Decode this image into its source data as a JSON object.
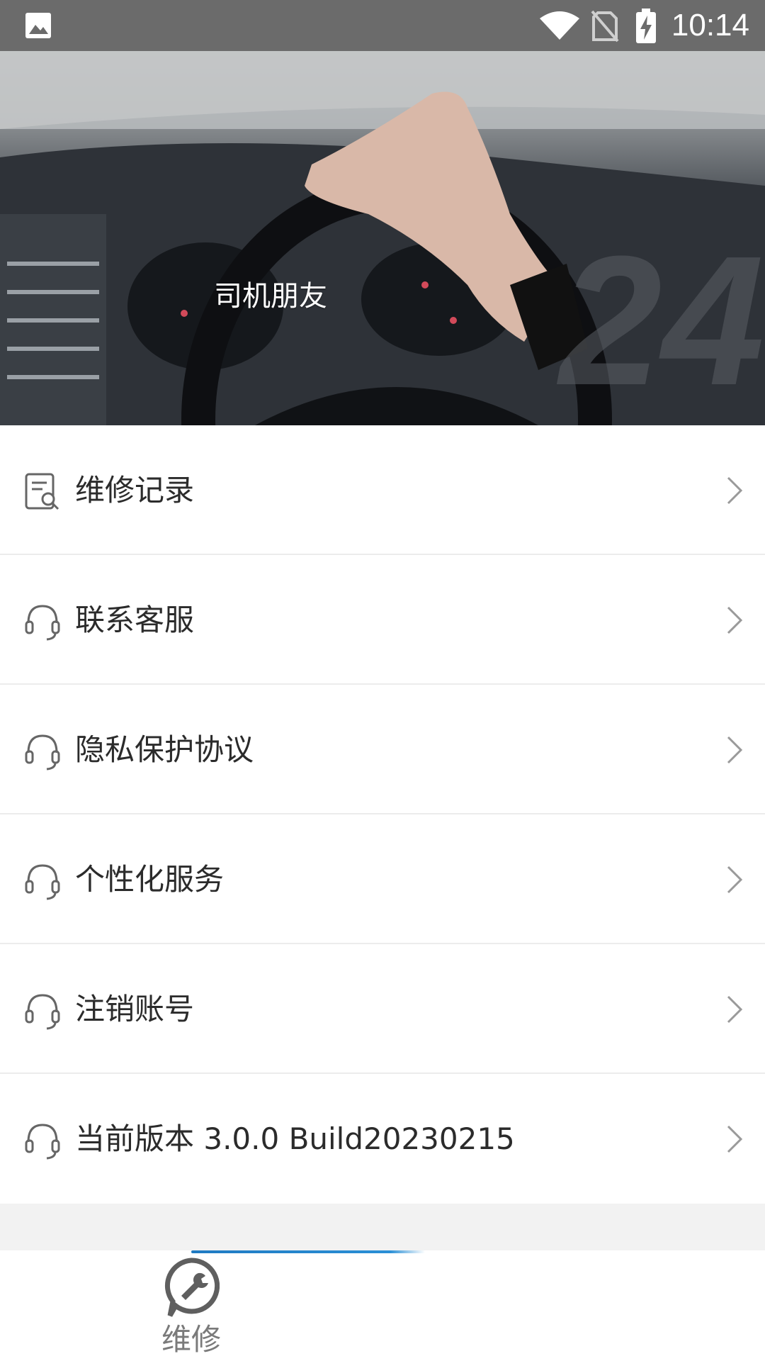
{
  "status_bar": {
    "time": "10:14",
    "icons": [
      "gallery-icon",
      "wifi-icon",
      "no-sim-icon",
      "battery-charging-icon"
    ]
  },
  "header": {
    "driver_name": "司机朋友",
    "background": "car-steering-wheel-photo",
    "watermark_logo": "24"
  },
  "menu": {
    "items": [
      {
        "label": "维修记录",
        "icon": "repair-record-icon"
      },
      {
        "label": "联系客服",
        "icon": "headset-icon"
      },
      {
        "label": "隐私保护协议",
        "icon": "headset-icon"
      },
      {
        "label": "个性化服务",
        "icon": "headset-icon"
      },
      {
        "label": "注销账号",
        "icon": "headset-icon"
      },
      {
        "label": "当前版本 3.0.0 Build20230215",
        "icon": "headset-icon"
      }
    ]
  },
  "tabbar": {
    "tabs": [
      {
        "label": "维修",
        "icon": "wrench-chat-icon",
        "active": true
      }
    ],
    "accent_color": "#1f7ac2"
  }
}
